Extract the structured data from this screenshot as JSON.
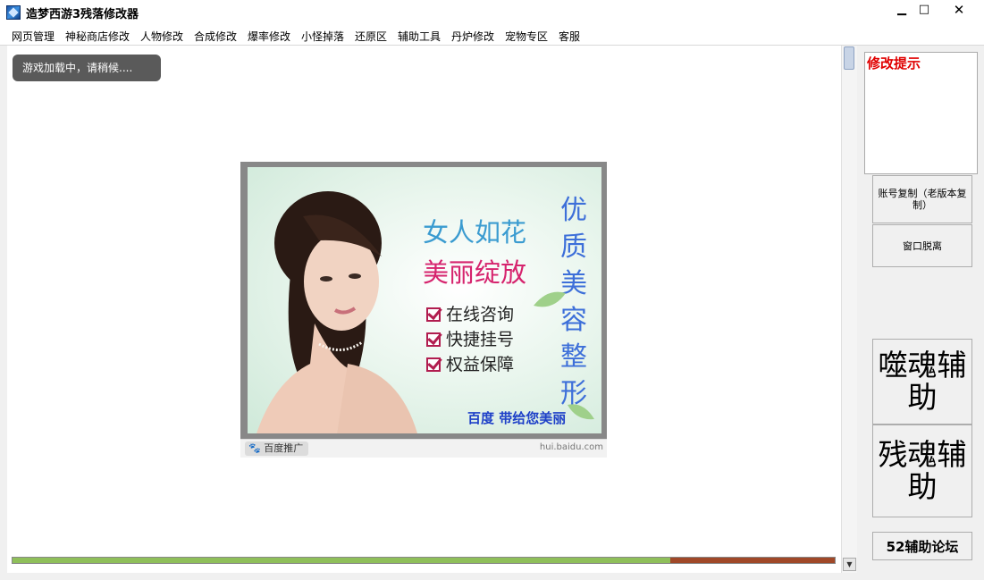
{
  "window": {
    "title": "造梦西游3残落修改器",
    "minimize_label": "▁",
    "maximize_label": "□",
    "close_label": "✕"
  },
  "menu": {
    "items": [
      "网页管理",
      "神秘商店修改",
      "人物修改",
      "合成修改",
      "爆率修改",
      "小怪掉落",
      "还原区",
      "辅助工具",
      "丹炉修改",
      "宠物专区",
      "客服"
    ]
  },
  "browser": {
    "loading_text": "游戏加载中，请稍候...."
  },
  "ad": {
    "line1": "女人如花",
    "line2": "美丽绽放",
    "checks": [
      "在线咨询",
      "快捷挂号",
      "权益保障"
    ],
    "vertical_text": [
      "优",
      "质",
      "美",
      "容",
      "整",
      "形"
    ],
    "slogan": "百度 带给您美丽",
    "footer_tag": "百度推广",
    "footer_url": "hui.baidu.com"
  },
  "progress": {
    "value": 0.8
  },
  "sidebar": {
    "tips_title": "修改提示",
    "copy_account_label": "账号复制（老版本复制）",
    "detach_window_label": "窗口脱离",
    "soul_helper_label": "噬魂辅助",
    "remnant_soul_helper_label": "残魂辅助",
    "forum_label": "52辅助论坛"
  },
  "colors": {
    "tips_title": "#e00000",
    "progress_fill": "#8fbf5a",
    "progress_track": "#a04828"
  }
}
